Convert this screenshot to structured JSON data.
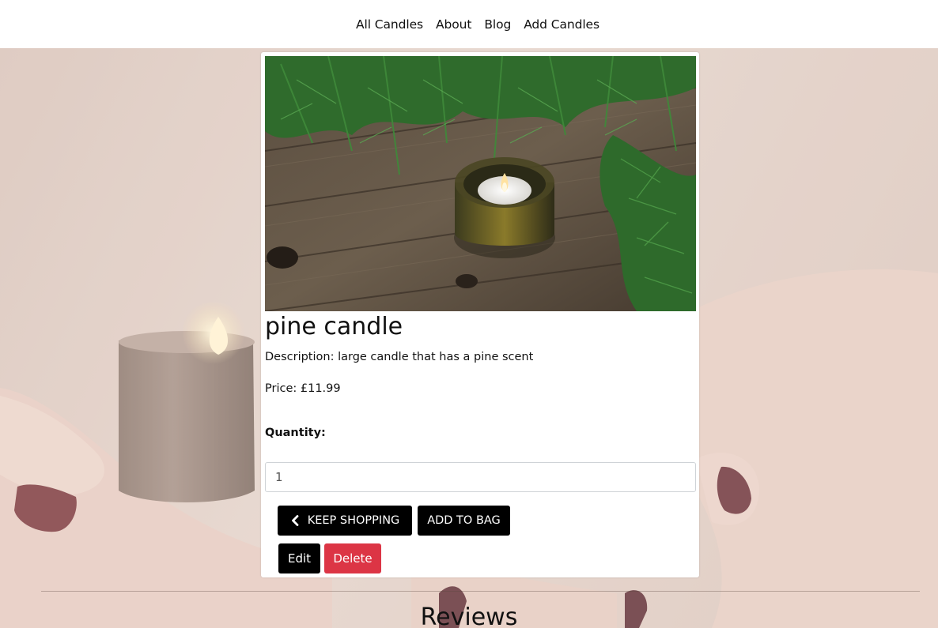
{
  "nav": {
    "links": [
      "All Candles",
      "About",
      "Blog",
      "Add Candles"
    ]
  },
  "product": {
    "title": "pine candle",
    "description": "Description: large candle that has a pine scent",
    "price": "Price: £11.99",
    "quantity_label": "Quantity:",
    "quantity_value": "1",
    "image_subject": "tealight candle in glass on wooden table with pine branches"
  },
  "actions": {
    "keep_shopping": "KEEP SHOPPING",
    "add_to_bag": "ADD TO BAG",
    "edit": "Edit",
    "delete": "Delete",
    "keep_shopping_icon": "chevron-left-icon"
  },
  "reviews": {
    "title": "Reviews"
  },
  "colors": {
    "primary_button": "#000000",
    "danger_button": "#dc3545",
    "navbar_bg": "#ffffff",
    "background_tint": "#dcc6bc"
  }
}
